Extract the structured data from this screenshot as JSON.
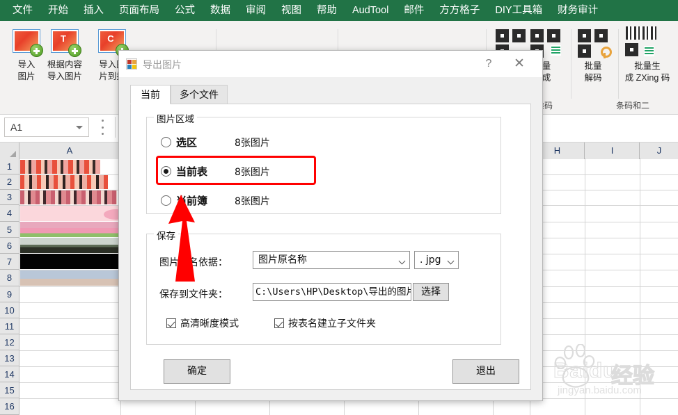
{
  "menubar": {
    "items": [
      {
        "label": "文件"
      },
      {
        "label": "开始"
      },
      {
        "label": "插入"
      },
      {
        "label": "页面布局"
      },
      {
        "label": "公式"
      },
      {
        "label": "数据"
      },
      {
        "label": "审阅"
      },
      {
        "label": "视图"
      },
      {
        "label": "帮助"
      },
      {
        "label": "AudTool"
      },
      {
        "label": "邮件"
      },
      {
        "label": "方方格子"
      },
      {
        "label": "DIY工具箱"
      },
      {
        "label": "财务审计"
      }
    ],
    "background": "#217346"
  },
  "ribbon": {
    "buttons": [
      {
        "label": "导入\n图片",
        "icon": "import-picture-icon",
        "letter": ""
      },
      {
        "label": "根据内容\n导入图片",
        "icon": "import-by-content-icon",
        "letter": "T"
      },
      {
        "label": "导入图\n片到批",
        "icon": "import-to-batch-icon",
        "letter": "C"
      }
    ],
    "qr_buttons": [
      {
        "label": "量\n成",
        "icon": "qr-batch-generate-icon"
      },
      {
        "label": "批量\n解码",
        "icon": "qr-batch-decode-icon"
      },
      {
        "label": "批量生\n成 ZXing 码",
        "icon": "barcode-zxing-icon"
      },
      {
        "label": "",
        "icon": "more-icon"
      }
    ],
    "group_labels": [
      {
        "label": "维码"
      },
      {
        "label": "条码和二"
      }
    ],
    "small_icons": [
      "export-picture-icon",
      "export-picture-green-icon",
      "folder-picture-icon",
      "picture-resize-icon",
      "picture-edit-icon",
      "blank-picture-icon",
      "picture-frame-icon",
      "picture-stack-icon",
      "more-commands-icon"
    ]
  },
  "formula_bar": {
    "name_box_value": "A1",
    "name_box_icon": "chevron-down-icon",
    "menu_icon": "vertical-dots-icon"
  },
  "grid": {
    "columns": [
      "A",
      "H",
      "I",
      "J"
    ],
    "rows": [
      "1",
      "2",
      "3",
      "4",
      "5",
      "6",
      "7",
      "8",
      "9",
      "10",
      "11",
      "12",
      "13",
      "14",
      "15",
      "16"
    ],
    "image_rows": 8
  },
  "dialog": {
    "title": "导出图片",
    "icon": "app-icon",
    "help_label": "?",
    "close_label": "✕",
    "tabs": [
      {
        "label": "当前",
        "active": true
      },
      {
        "label": "多个文件",
        "active": false
      }
    ],
    "area_group": {
      "legend": "图片区域",
      "options": [
        {
          "label": "选区",
          "count": "8张图片",
          "selected": false
        },
        {
          "label": "当前表",
          "count": "8张图片",
          "selected": true
        },
        {
          "label": "当前簿",
          "count": "8张图片",
          "selected": false
        }
      ],
      "highlight_color": "#ff0000"
    },
    "save_group": {
      "legend": "保存",
      "naming_label": "图片命名依据：",
      "naming_value": "图片原名称",
      "format_value": ". jpg",
      "folder_label": "保存到文件夹：",
      "folder_value": "C:\\Users\\HP\\Desktop\\导出的图片",
      "choose_button": "选择",
      "checkboxes": [
        {
          "label": "高清晰度模式",
          "checked": true
        },
        {
          "label": "按表名建立子文件夹",
          "checked": true
        }
      ]
    },
    "buttons": {
      "confirm": "确定",
      "exit": "退出"
    }
  },
  "watermark": {
    "brand": "Baidu",
    "product": "经验",
    "url": "jingyan.baidu.com"
  }
}
